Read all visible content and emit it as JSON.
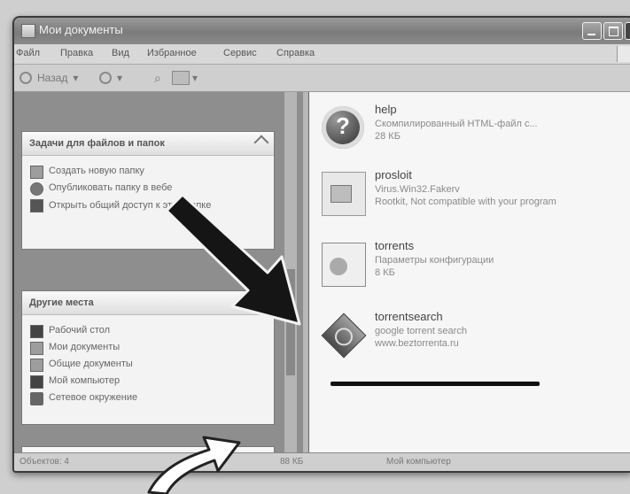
{
  "window": {
    "title": "Мои документы",
    "menu": [
      "Файл",
      "Правка",
      "Вид",
      "Избранное",
      "Сервис",
      "Справка"
    ],
    "toolbar": {
      "back": "Назад",
      "forward": ""
    }
  },
  "tasks_panel": {
    "title": "Задачи для файлов и папок",
    "items": [
      "Создать новую папку",
      "Опубликовать папку в вебе",
      "Открыть общий доступ к этой папке"
    ]
  },
  "places_panel": {
    "title": "Другие места",
    "items": [
      "Рабочий стол",
      "Мои документы",
      "Общие документы",
      "Мой компьютер",
      "Сетевое окружение"
    ]
  },
  "files": [
    {
      "name": "help",
      "line1": "Скомпилированный HTML-файл с...",
      "line2": "28 КБ"
    },
    {
      "name": "prosloit",
      "line1": "Virus.Win32.Fakerv",
      "line2": "Rootkit, Not compatible with your program"
    },
    {
      "name": "torrents",
      "line1": "Параметры конфигурации",
      "line2": "8 КБ"
    },
    {
      "name": "torrentsearch",
      "line1": "google torrent search",
      "line2": "www.beztorrenta.ru"
    }
  ],
  "status": {
    "left": "Объектов: 4",
    "middle": "88 КБ",
    "right": "Мой компьютер"
  },
  "colors": {
    "arrow": "#1a1a1a",
    "highlight_line": "#111111"
  },
  "icons": {
    "help": "help-file-icon",
    "prosloit": "document-icon",
    "torrents": "config-file-icon",
    "torrentsearch": "app-diamond-icon"
  }
}
